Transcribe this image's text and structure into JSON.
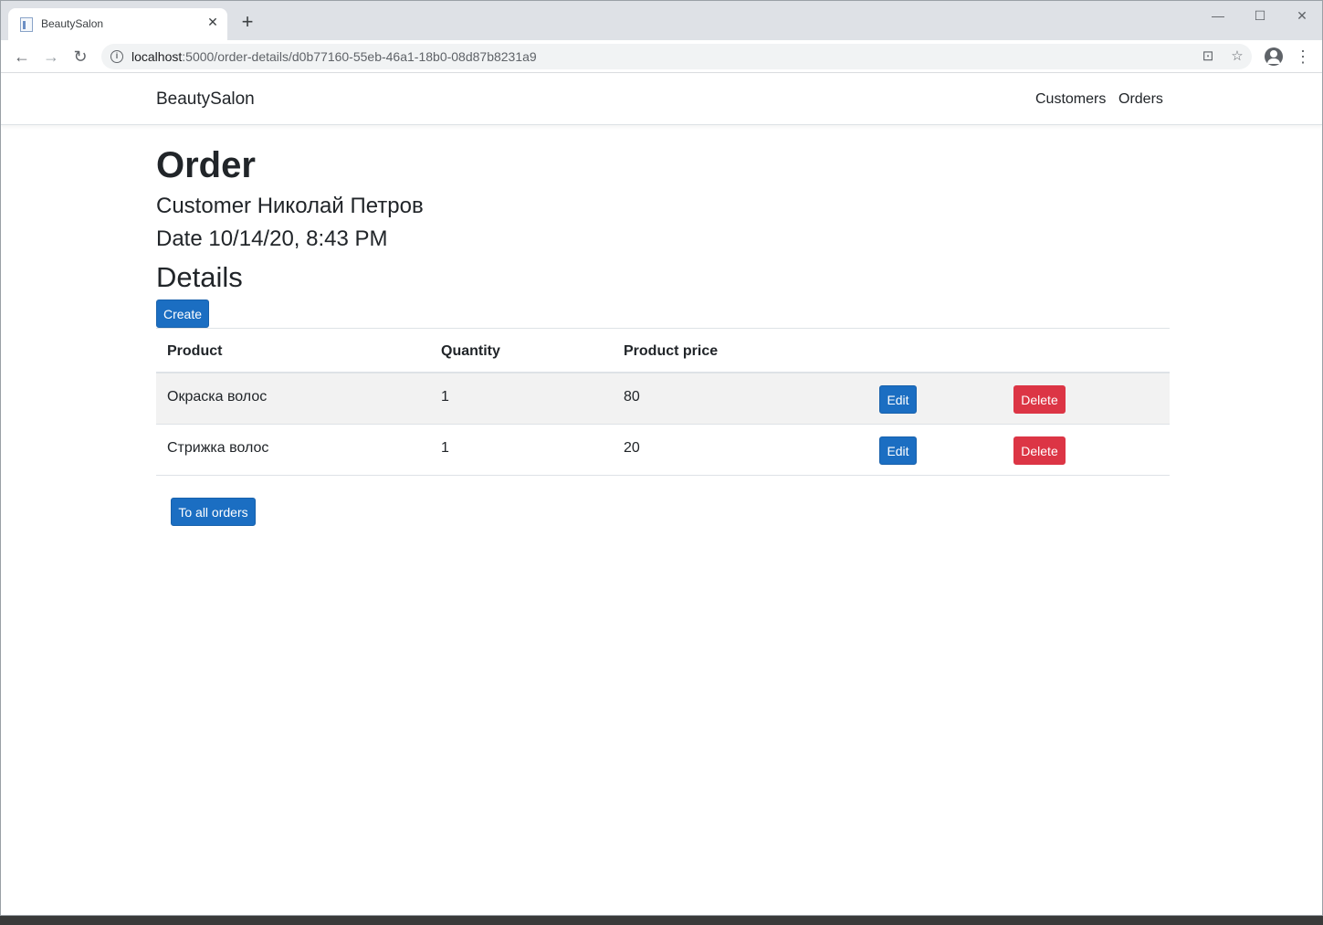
{
  "browser": {
    "tab_title": "BeautySalon",
    "url_host": "localhost",
    "url_rest": ":5000/order-details/d0b77160-55eb-46a1-18b0-08d87b8231a9"
  },
  "navbar": {
    "brand": "BeautySalon",
    "links": [
      "Customers",
      "Orders"
    ]
  },
  "order": {
    "title": "Order",
    "customer": "Customer Николай Петров",
    "date": "Date 10/14/20, 8:43 PM",
    "details_heading": "Details",
    "create_label": "Create",
    "to_all_orders_label": "To all orders"
  },
  "table": {
    "headers": [
      "Product",
      "Quantity",
      "Product price"
    ],
    "rows": [
      {
        "product": "Окраска волос",
        "quantity": "1",
        "price": "80",
        "edit": "Edit",
        "delete": "Delete"
      },
      {
        "product": "Стрижка волос",
        "quantity": "1",
        "price": "20",
        "edit": "Edit",
        "delete": "Delete"
      }
    ]
  },
  "colors": {
    "primary": "#1b6ec2",
    "danger": "#dc3545",
    "stripe": "#f2f2f2"
  }
}
